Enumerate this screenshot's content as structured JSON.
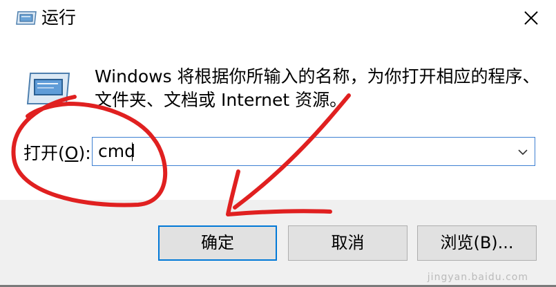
{
  "window": {
    "title": "运行"
  },
  "body": {
    "description_line1": "Windows 将根据你所输入的名称，为你打开相应的程序、",
    "description_line2": "文件夹、文档或 Internet 资源。",
    "open_label_prefix": "打开(",
    "open_label_key": "O",
    "open_label_suffix": "):",
    "open_value": "cmd"
  },
  "buttons": {
    "ok": "确定",
    "cancel": "取消",
    "browse": "浏览(B)..."
  },
  "watermark": {
    "site": "jingyan.baidu.com"
  },
  "colors": {
    "focus_blue": "#0078d7",
    "annotation_red": "#e02020",
    "footer_gray": "#f0f0f0"
  },
  "icons": {
    "title": "run-app-icon",
    "close": "close-icon",
    "body": "run-app-icon",
    "dropdown": "chevron-down-icon"
  }
}
